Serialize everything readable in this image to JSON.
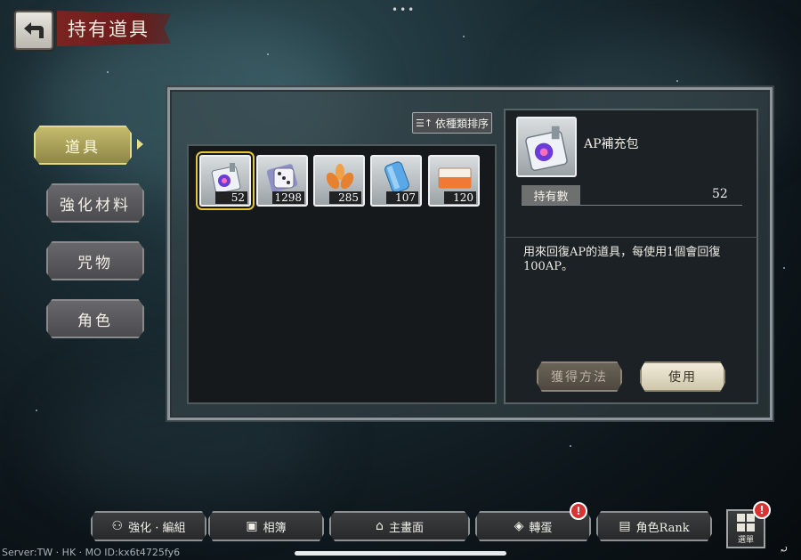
{
  "header": {
    "title": "持有道具",
    "top_dots": "•••"
  },
  "categories": [
    {
      "label": "道具",
      "active": true
    },
    {
      "label": "強化材料",
      "active": false
    },
    {
      "label": "咒物",
      "active": false
    },
    {
      "label": "角色",
      "active": false
    }
  ],
  "sort_button": {
    "label": "依種類排序"
  },
  "items": [
    {
      "name": "ap-refill-pack",
      "count": "52",
      "selected": true
    },
    {
      "name": "dice-tickets",
      "count": "1298",
      "selected": false
    },
    {
      "name": "orange-petals",
      "count": "285",
      "selected": false
    },
    {
      "name": "blue-cylinder",
      "count": "107",
      "selected": false
    },
    {
      "name": "orange-ticket",
      "count": "120",
      "selected": false
    }
  ],
  "detail": {
    "name": "AP補充包",
    "owned_label": "持有數",
    "owned_value": "52",
    "description": "用來回復AP的道具，每使用1個會回復100AP。",
    "obtain_button": "獲得方法",
    "use_button": "使用"
  },
  "bottom_nav": [
    {
      "label": "強化 · 編組",
      "icon": "people-icon",
      "badge": ""
    },
    {
      "label": "相簿",
      "icon": "photo-icon",
      "badge": ""
    },
    {
      "label": "主畫面",
      "icon": "building-icon",
      "badge": ""
    },
    {
      "label": "轉蛋",
      "icon": "gacha-icon",
      "badge": "!"
    },
    {
      "label": "角色Rank",
      "icon": "character-icon",
      "badge": ""
    }
  ],
  "menu": {
    "label": "選單",
    "badge": "!"
  },
  "server_info": "Server:TW · HK · MO ID:kx6t4725fy6",
  "colors": {
    "accent_gold": "#c4bb6e",
    "title_red": "#7a2422",
    "badge_red": "#d83434"
  }
}
